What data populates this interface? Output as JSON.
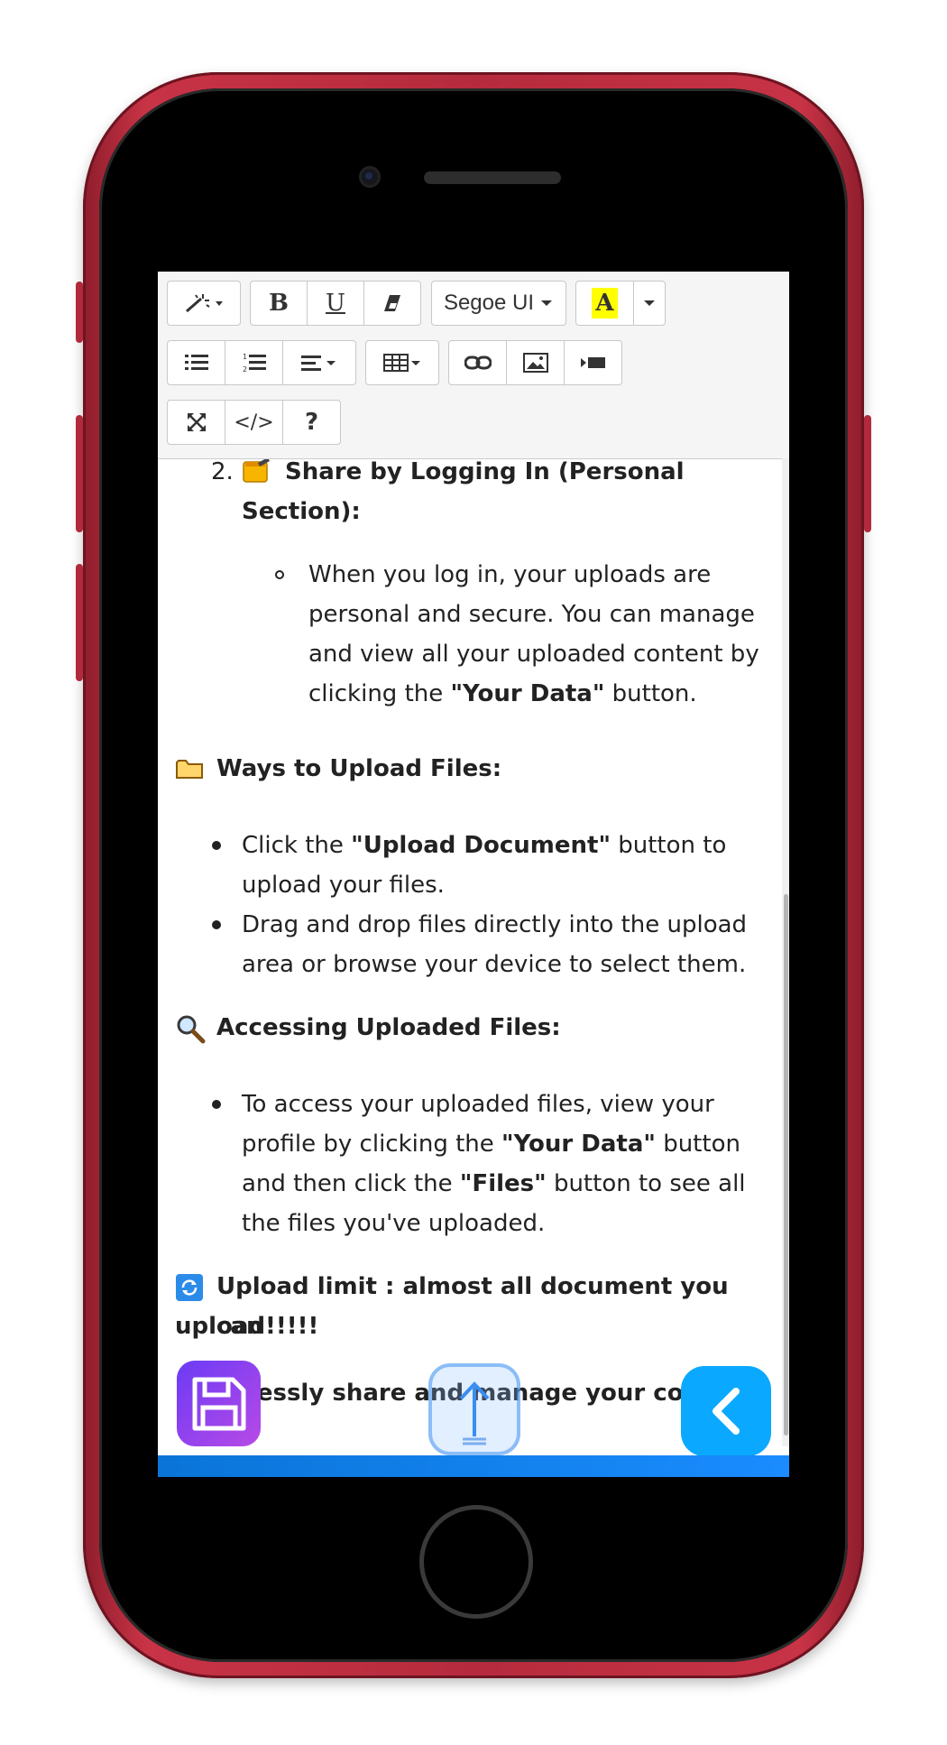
{
  "toolbar": {
    "font_name": "Segoe UI",
    "bold_label": "B",
    "underline_label": "U",
    "highlight_label": "A",
    "code_label": "</>",
    "help_label": "?",
    "highlight_color": "#ffff00"
  },
  "content": {
    "list_number": "2.",
    "section1_title_line1": "Share by Logging In (Personal",
    "section1_title_line2": "Section):",
    "section1_item": {
      "l1": "When you log in, your uploads are",
      "l2": "personal and secure. You can manage",
      "l3": "and view all your uploaded content by",
      "l4a": "clicking the ",
      "l4b": "\"Your Data\"",
      "l4c": " button."
    },
    "section2_title": "Ways to Upload Files:",
    "section2_items": {
      "i1a": "Click the ",
      "i1b": "\"Upload Document\"",
      "i1c": " button to",
      "i1d": "upload your files.",
      "i2a": "Drag and drop files directly into the upload",
      "i2b": "area or browse your device to select them."
    },
    "section3_title": "Accessing Uploaded Files:",
    "section3_item": {
      "l1": "To access your uploaded files, view your",
      "l2a": "profile by clicking the ",
      "l2b": "\"Your Data\"",
      "l2c": " button",
      "l3a": "and then click the ",
      "l3b": "\"Files\"",
      "l3c": " button to see all",
      "l4": "the files you've uploaded."
    },
    "section4_title_line1": "Upload limit : almost all document you can",
    "section4_title_line2": "upload!!!!!",
    "footer_text": "Effortlessly share and manage your content!"
  },
  "icons": {
    "magic": "magic-wand-icon",
    "eraser": "eraser-icon",
    "ul": "unordered-list-icon",
    "ol": "ordered-list-icon",
    "align": "align-icon",
    "table": "table-icon",
    "link": "link-icon",
    "image": "image-icon",
    "video": "video-icon",
    "fullscreen": "fullscreen-icon",
    "save": "save-icon",
    "upload": "upload-icon",
    "back": "back-chevron-icon"
  },
  "colors": {
    "phone_frame": "#b52b3d",
    "accent_blue": "#0a84ff",
    "save_gradient_start": "#6b3bf5",
    "save_gradient_end": "#b84ae6"
  }
}
